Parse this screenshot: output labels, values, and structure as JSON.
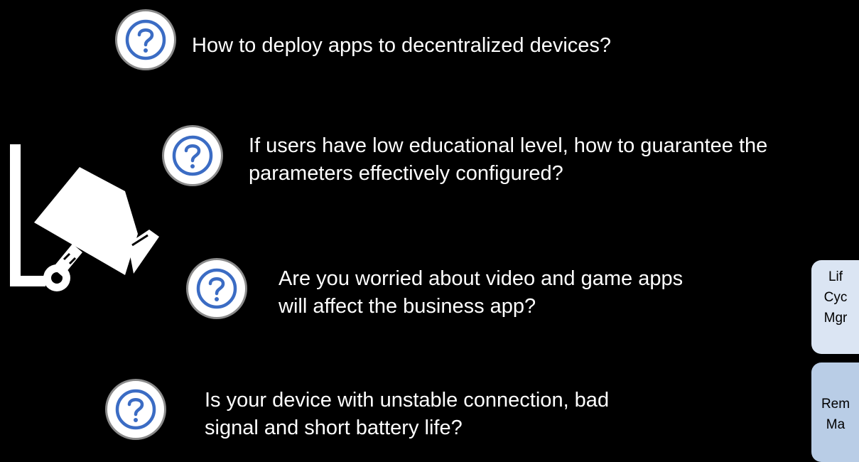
{
  "questions": [
    {
      "text_lines": [
        "How to deploy apps to decentralized devices?"
      ]
    },
    {
      "text_lines": [
        "If users have low educational level, how to guarantee the",
        "parameters effectively configured?"
      ]
    },
    {
      "text_lines": [
        "Are you worried about video and game apps",
        "will affect the business app?"
      ]
    },
    {
      "text_lines": [
        "Is your device with unstable connection, bad",
        "signal and short battery life?"
      ]
    }
  ],
  "question_icon": "question-circle-icon",
  "camera_icon": "security-camera-icon",
  "side_cards": [
    {
      "lines": [
        "Lif",
        "Cyc",
        "Mgr"
      ]
    },
    {
      "lines": [
        "Rem",
        "Ma"
      ]
    }
  ],
  "colors": {
    "background": "#000000",
    "question_blue": "#3b6cc4",
    "badge_border": "#8a8a8a",
    "card_light": "#dbe5f3",
    "card_medium": "#b9cde6"
  }
}
